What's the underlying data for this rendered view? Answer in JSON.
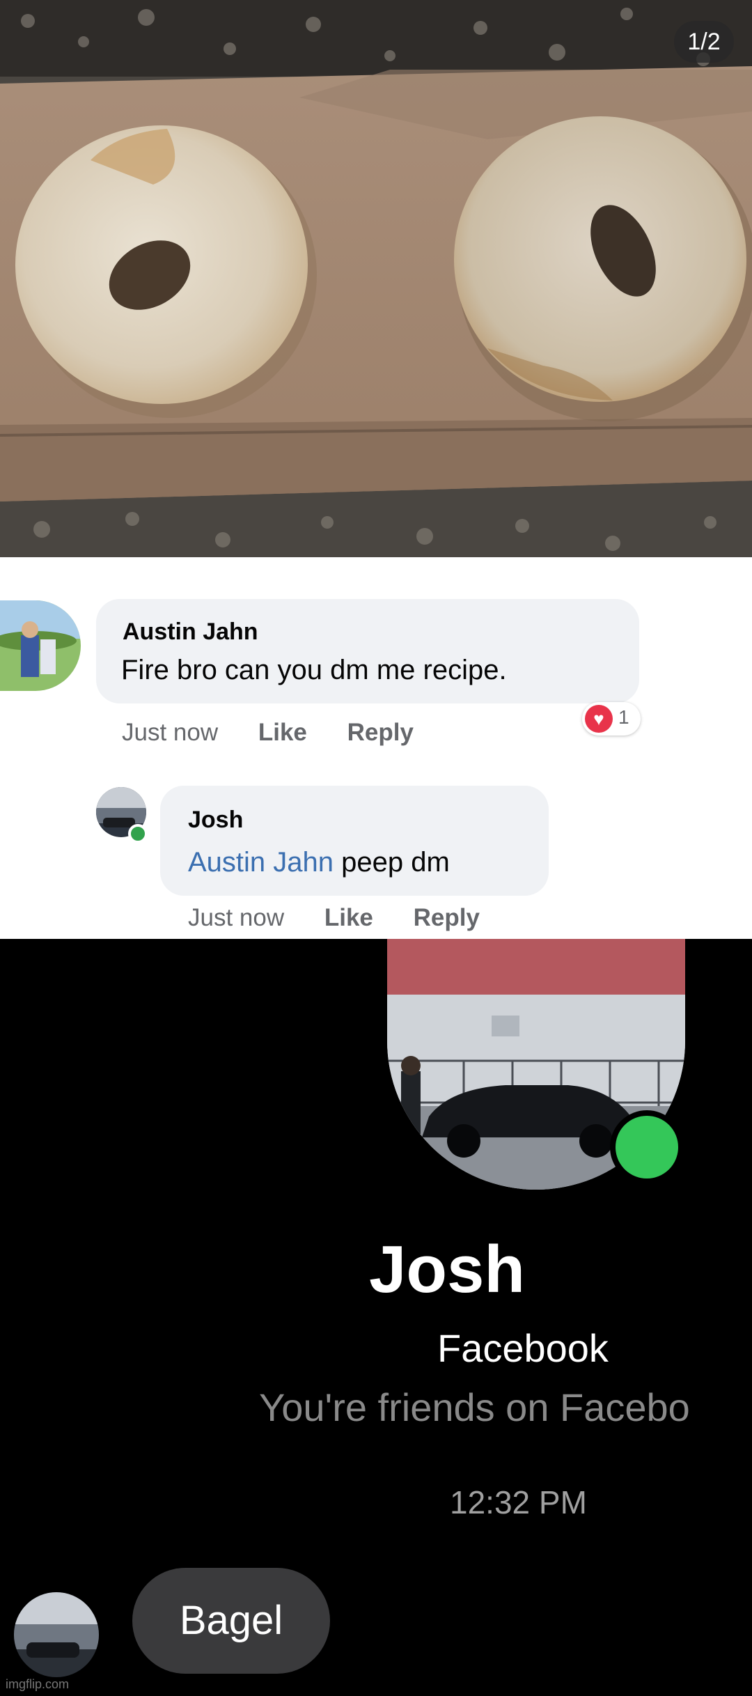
{
  "photo": {
    "page_indicator": "1/2"
  },
  "comments": [
    {
      "author": "Austin Jahn",
      "text": "Fire bro can you dm me recipe.",
      "time": "Just now",
      "like_label": "Like",
      "reply_label": "Reply",
      "reaction_count": "1"
    },
    {
      "author": "Josh",
      "mention": "Austin Jahn",
      "text": " peep dm",
      "time": "Just now",
      "like_label": "Like",
      "reply_label": "Reply"
    }
  ],
  "messenger": {
    "name": "Josh",
    "platform": "Facebook",
    "relationship": "You're friends on Facebo",
    "time": "12:32 PM",
    "message": "Bagel"
  },
  "watermark": "imgflip.com",
  "colors": {
    "mention": "#3b6fb0",
    "online": "#34c759",
    "reaction": "#e8334a"
  }
}
